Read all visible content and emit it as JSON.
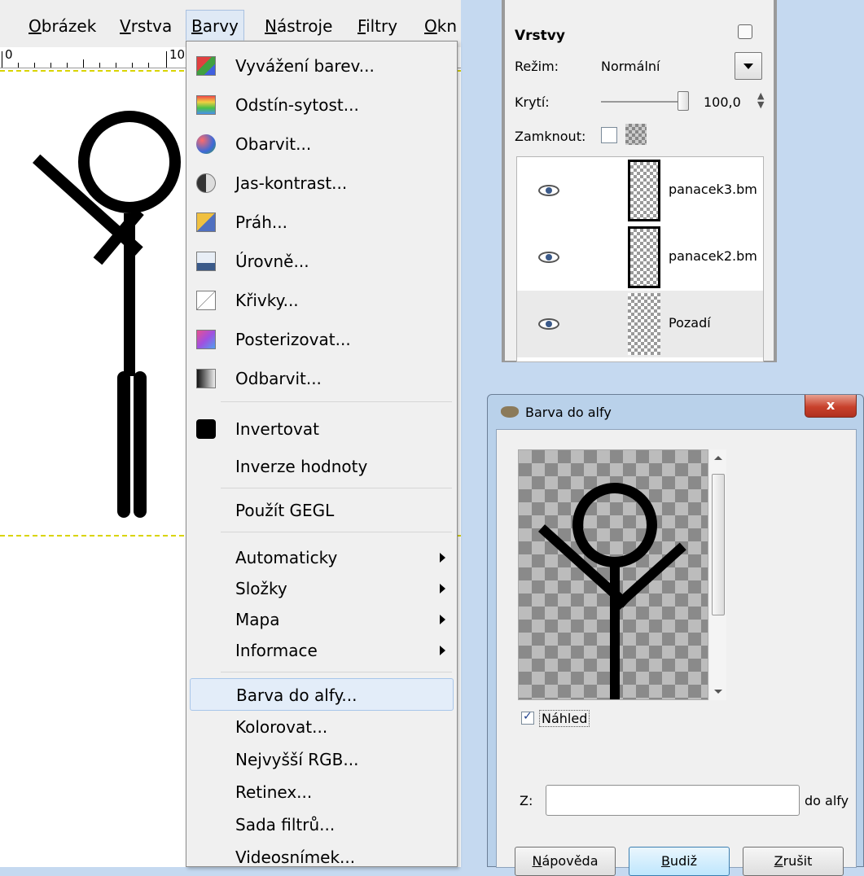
{
  "menubar": {
    "items": [
      {
        "label": "Obrázek"
      },
      {
        "label": "Vrstva"
      },
      {
        "label": "Barvy"
      },
      {
        "label": "Nástroje"
      },
      {
        "label": "Filtry"
      },
      {
        "label": "Okn"
      }
    ],
    "active_item": "Barvy"
  },
  "ruler": {
    "labels": [
      "0",
      "10"
    ]
  },
  "colors_menu": {
    "items": [
      {
        "label": "Vyvážení barev...",
        "icon": "color-balance-icon"
      },
      {
        "label": "Odstín-sytost...",
        "icon": "hue-saturation-icon"
      },
      {
        "label": "Obarvit...",
        "icon": "colorize-icon"
      },
      {
        "label": "Jas-kontrast...",
        "icon": "brightness-contrast-icon"
      },
      {
        "label": "Práh...",
        "icon": "threshold-icon"
      },
      {
        "label": "Úrovně...",
        "icon": "levels-icon"
      },
      {
        "label": "Křivky...",
        "icon": "curves-icon"
      },
      {
        "label": "Posterizovat...",
        "icon": "posterize-icon"
      },
      {
        "label": "Odbarvit...",
        "icon": "desaturate-icon"
      },
      {
        "label": "Invertovat",
        "icon": "invert-icon"
      },
      {
        "label": "Inverze hodnoty"
      },
      {
        "label": "Použít GEGL"
      },
      {
        "label": "Automaticky",
        "submenu": true
      },
      {
        "label": "Složky",
        "submenu": true
      },
      {
        "label": "Mapa",
        "submenu": true
      },
      {
        "label": "Informace",
        "submenu": true
      },
      {
        "label": "Barva do alfy...",
        "highlighted": true
      },
      {
        "label": "Kolorovat..."
      },
      {
        "label": "Nejvyšší RGB..."
      },
      {
        "label": "Retinex..."
      },
      {
        "label": "Sada filtrů..."
      },
      {
        "label": "Videosnímek..."
      }
    ]
  },
  "layers": {
    "title": "Vrstvy",
    "mode_label": "Režim:",
    "mode_value": "Normální",
    "opacity_label": "Krytí:",
    "opacity_value": "100,0",
    "lock_label": "Zamknout:",
    "rows": [
      {
        "name": "panacek3.bm"
      },
      {
        "name": "panacek2.bm"
      },
      {
        "name": "Pozadí"
      }
    ]
  },
  "dialog": {
    "title": "Barva do alfy",
    "close": "x",
    "preview_label": "Náhled",
    "preview_checked": true,
    "from_label": "Z:",
    "to_label": "do alfy",
    "buttons": {
      "help": "Nápověda",
      "ok": "Budiž",
      "cancel": "Zrušit"
    }
  },
  "colors": {
    "desktop": "#c5d9f0",
    "menu_highlight": "#e3edf9",
    "dialog_frame": "#b9d1ea"
  }
}
